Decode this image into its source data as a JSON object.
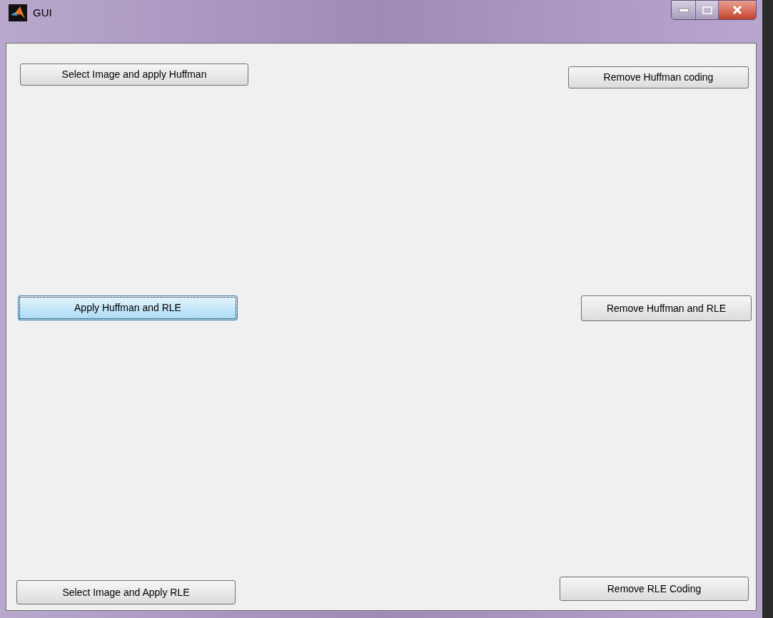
{
  "window": {
    "title": "GUI"
  },
  "buttons": [
    {
      "label": "Select Image and apply Huffman",
      "focused": false
    },
    {
      "label": "Remove Huffman coding",
      "focused": false
    },
    {
      "label": "Apply Huffman and RLE",
      "focused": true
    },
    {
      "label": "Remove Huffman and RLE",
      "focused": false
    },
    {
      "label": "Select Image and Apply RLE",
      "focused": false
    },
    {
      "label": "Remove RLE Coding",
      "focused": false
    }
  ]
}
